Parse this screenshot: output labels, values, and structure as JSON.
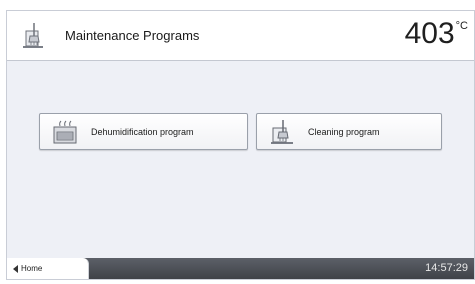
{
  "header": {
    "title": "Maintenance Programs",
    "temperature": "403",
    "temperature_unit": "°C",
    "icon": "cleaning-brush-icon"
  },
  "programs": [
    {
      "label": "Dehumidification program",
      "icon": "dehumidification-furnace-icon"
    },
    {
      "label": "Cleaning program",
      "icon": "cleaning-brush-icon"
    }
  ],
  "footer": {
    "home_label": "Home",
    "time": "14:57:29"
  },
  "colors": {
    "background": "#eef0f6",
    "footer_bar": "#4a4d54",
    "button_border": "#9aa0aa"
  }
}
